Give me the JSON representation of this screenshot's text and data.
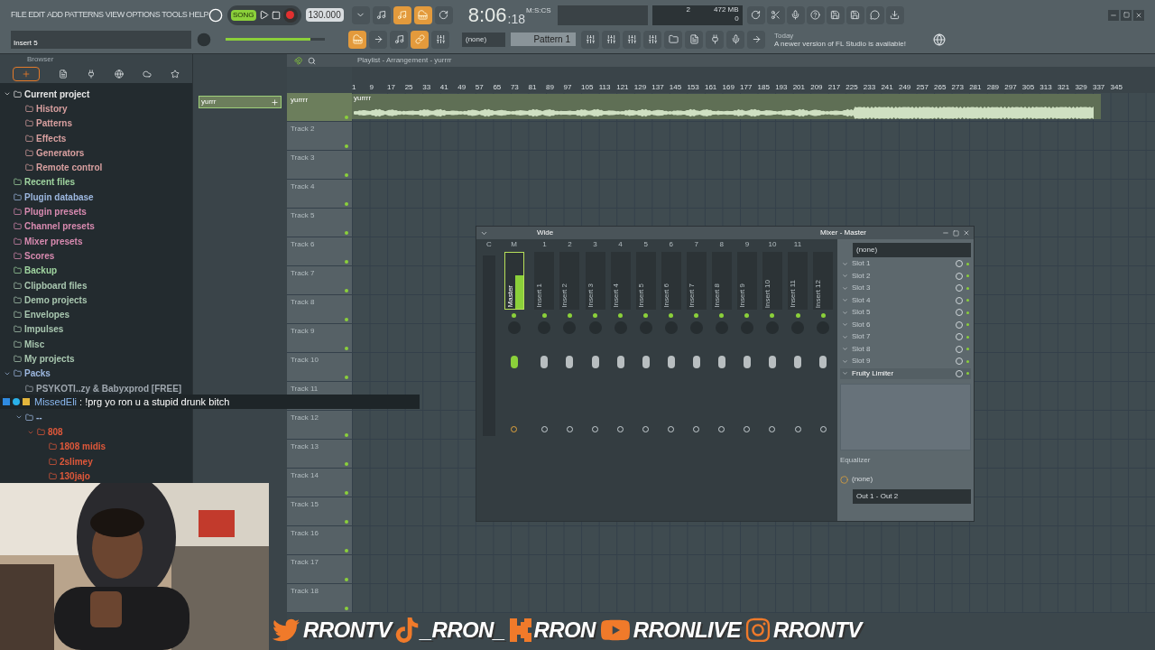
{
  "menu": [
    "FILE",
    "EDIT",
    "ADD",
    "PATTERNS",
    "VIEW",
    "OPTIONS",
    "TOOLS",
    "HELP"
  ],
  "transport": {
    "mode": "SONG",
    "tempo": "130.000",
    "time": "8:06",
    "time_sub": ":18",
    "time_unit": "M:S:CS"
  },
  "monitor": {
    "cpu": "2",
    "memory": "472 MB",
    "polyphony": "0"
  },
  "hint": "Insert 5",
  "master_volume": {
    "level": 0.85
  },
  "pattern": {
    "selector": "(none)",
    "name": "Pattern 1"
  },
  "news": {
    "date": "Today",
    "text": "A newer version of FL Studio is available!"
  },
  "browser": {
    "title": "Browser",
    "items": [
      {
        "label": "Current project",
        "color": "#e6e6e6",
        "expanded": true,
        "children": [
          {
            "label": "History",
            "color": "#d9a0a0"
          },
          {
            "label": "Patterns",
            "color": "#d9a0a0"
          },
          {
            "label": "Effects",
            "color": "#d9a0a0"
          },
          {
            "label": "Generators",
            "color": "#d9a0a0"
          },
          {
            "label": "Remote control",
            "color": "#d9a0a0"
          }
        ]
      },
      {
        "label": "Recent files",
        "color": "#9fd49f"
      },
      {
        "label": "Plugin database",
        "color": "#9db8e0"
      },
      {
        "label": "Plugin presets",
        "color": "#d88ab0"
      },
      {
        "label": "Channel presets",
        "color": "#d88ab0"
      },
      {
        "label": "Mixer presets",
        "color": "#d88ab0"
      },
      {
        "label": "Scores",
        "color": "#d88ab0"
      },
      {
        "label": "Backup",
        "color": "#9fd49f"
      },
      {
        "label": "Clipboard files",
        "color": "#a9c7b0"
      },
      {
        "label": "Demo projects",
        "color": "#a9c7b0"
      },
      {
        "label": "Envelopes",
        "color": "#a9c7b0"
      },
      {
        "label": "Impulses",
        "color": "#a9c7b0"
      },
      {
        "label": "Misc",
        "color": "#a9c7b0"
      },
      {
        "label": "My projects",
        "color": "#a9c7b0"
      },
      {
        "label": "Packs",
        "color": "#9db8e0",
        "expanded": true,
        "children": [
          {
            "label": "PSYKOTI..zy & Babyxprod [FREE]",
            "color": "#a0a8b0"
          },
          {
            "label": "--",
            "color": "#9db8e0",
            "expanded": true,
            "children": [
              {
                "label": "808",
                "color": "#e0583a",
                "expanded": true,
                "children": [
                  {
                    "label": "1808 midis",
                    "color": "#e0583a"
                  },
                  {
                    "label": "2slimey",
                    "color": "#e0583a"
                  },
                  {
                    "label": "130jajo",
                    "color": "#e0583a"
                  }
                ]
              }
            ]
          }
        ]
      }
    ]
  },
  "channel_rack": {
    "clip": "yurrr"
  },
  "playlist": {
    "title": "Playlist - Arrangement - yurrrr",
    "clip": "yurrrr",
    "ruler": [
      "1",
      "9",
      "17",
      "25",
      "33",
      "41",
      "49",
      "57",
      "65",
      "73",
      "81",
      "89",
      "97",
      "105",
      "113",
      "121",
      "129",
      "137",
      "145",
      "153",
      "161",
      "169",
      "177",
      "185",
      "193",
      "201",
      "209",
      "217",
      "225",
      "233",
      "241",
      "249",
      "257",
      "265",
      "273",
      "281",
      "289",
      "297",
      "305",
      "313",
      "321",
      "329",
      "337",
      "345"
    ],
    "tracks": [
      "yurrrr",
      "Track 2",
      "Track 3",
      "Track 4",
      "Track 5",
      "Track 6",
      "Track 7",
      "Track 8",
      "Track 9",
      "Track 10",
      "Track 11",
      "Track 12",
      "Track 13",
      "Track 14",
      "Track 15",
      "Track 16",
      "Track 17",
      "Track 18"
    ]
  },
  "mixer": {
    "preset": "Wide",
    "scale_header": "C",
    "title": "Mixer - Master",
    "input": "(none)",
    "strips": [
      {
        "kind": "master",
        "header": "M",
        "name": "Master",
        "level": 0.6
      },
      {
        "kind": "insert",
        "header": "1",
        "name": "Insert 1"
      },
      {
        "kind": "insert",
        "header": "2",
        "name": "Insert 2"
      },
      {
        "kind": "insert",
        "header": "3",
        "name": "Insert 3"
      },
      {
        "kind": "insert",
        "header": "4",
        "name": "Insert 4"
      },
      {
        "kind": "insert",
        "header": "5",
        "name": "Insert 5"
      },
      {
        "kind": "insert",
        "header": "6",
        "name": "Insert 6"
      },
      {
        "kind": "insert",
        "header": "7",
        "name": "Insert 7"
      },
      {
        "kind": "insert",
        "header": "8",
        "name": "Insert 8"
      },
      {
        "kind": "insert",
        "header": "9",
        "name": "Insert 9"
      },
      {
        "kind": "insert",
        "header": "10",
        "name": "Insert 10"
      },
      {
        "kind": "insert",
        "header": "11",
        "name": "Insert 11"
      },
      {
        "kind": "insert",
        "name": "Insert 12"
      }
    ],
    "slots": [
      {
        "kind": "empty",
        "label": "Slot 1"
      },
      {
        "kind": "empty",
        "label": "Slot 2"
      },
      {
        "kind": "empty",
        "label": "Slot 3"
      },
      {
        "kind": "empty",
        "label": "Slot 4"
      },
      {
        "kind": "empty",
        "label": "Slot 5"
      },
      {
        "kind": "empty",
        "label": "Slot 6"
      },
      {
        "kind": "empty",
        "label": "Slot 7"
      },
      {
        "kind": "empty",
        "label": "Slot 8"
      },
      {
        "kind": "empty",
        "label": "Slot 9"
      },
      {
        "kind": "plugin",
        "label": "Fruity Limiter"
      }
    ],
    "equalizer": "Equalizer",
    "send": "(none)",
    "output": "Out 1 - Out 2"
  },
  "chat": {
    "user": "MissedEli",
    "message": ": !prg yo ron u a stupid drunk bitch"
  },
  "socials": [
    {
      "kind": "twitter",
      "handle": "RRONTV"
    },
    {
      "kind": "tiktok",
      "handle": "_RRON_"
    },
    {
      "kind": "kick",
      "handle": "RRON"
    },
    {
      "kind": "youtube",
      "handle": "RRONLIVE"
    },
    {
      "kind": "instagram",
      "handle": "RRONTV"
    }
  ]
}
